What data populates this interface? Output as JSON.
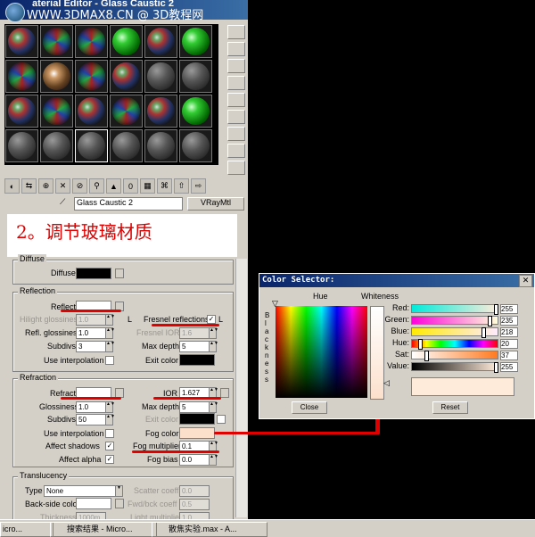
{
  "material_editor": {
    "title": "aterial Editor - Glass Caustic 2",
    "watermark": "WWW.3DMAX8.CN @ 3D教程网",
    "material_name": "Glass Caustic 2",
    "material_type": "VRayMtl",
    "annotation": "2。调节玻璃材质",
    "diffuse": {
      "title": "Diffuse",
      "label": "Diffuse"
    },
    "reflection": {
      "title": "Reflection",
      "reflect": "Reflect",
      "hilight_glossiness": "Hilight glossiness",
      "hilight_value": "1.0",
      "refl_glossiness": "Refl. glossiness",
      "refl_glossiness_value": "1.0",
      "subdivs": "Subdivs",
      "subdivs_value": "3",
      "use_interpolation": "Use interpolation",
      "fresnel": "Fresnel reflections",
      "fresnel_ior": "Fresnel IOR",
      "fresnel_ior_value": "1.6",
      "max_depth": "Max depth",
      "max_depth_value": "5",
      "exit_color": "Exit color",
      "l": "L"
    },
    "refraction": {
      "title": "Refraction",
      "refract": "Refract",
      "glossiness": "Glossiness",
      "glossiness_value": "1.0",
      "subdivs": "Subdivs",
      "subdivs_value": "50",
      "use_interpolation": "Use interpolation",
      "affect_shadows": "Affect shadows",
      "affect_alpha": "Affect alpha",
      "ior": "IOR",
      "ior_value": "1.627",
      "max_depth": "Max depth",
      "max_depth_value": "5",
      "exit_color": "Exit color",
      "fog_color": "Fog color",
      "fog_multiplier": "Fog multiplier",
      "fog_multiplier_value": "0.1",
      "fog_bias": "Fog bias",
      "fog_bias_value": "0.0"
    },
    "translucency": {
      "title": "Translucency",
      "type": "Type",
      "type_value": "None",
      "backside": "Back-side color",
      "thickness": "Thickness",
      "thickness_value": "1000m",
      "scatter": "Scatter coeff",
      "scatter_value": "0.0",
      "fwd_bck": "Fwd/bck coeff",
      "fwd_bck_value": "0.5",
      "light_mult": "Light multiplier",
      "light_mult_value": "1.0"
    }
  },
  "color_selector": {
    "title": "Color Selector:",
    "hue_label": "Hue",
    "whiteness_label": "Whiteness",
    "blackness_label": "B l a c k n e s s",
    "channels": [
      {
        "label": "Red:",
        "value": "255",
        "level": 1.0
      },
      {
        "label": "Green:",
        "value": "235",
        "level": 0.92
      },
      {
        "label": "Blue:",
        "value": "218",
        "level": 0.85
      },
      {
        "label": "Hue:",
        "value": "20",
        "level": 0.08
      },
      {
        "label": "Sat:",
        "value": "37",
        "level": 0.15
      },
      {
        "label": "Value:",
        "value": "255",
        "level": 1.0
      }
    ],
    "close": "Close",
    "reset": "Reset",
    "preview_color": "#FFEBDA"
  },
  "taskbar": {
    "start": "icro...",
    "task1": "搜索结果 - Micro...",
    "task2": "散焦实验.max - A..."
  },
  "colors": {
    "annotation_red": "#e00000",
    "title_blue": "#0a246a"
  }
}
